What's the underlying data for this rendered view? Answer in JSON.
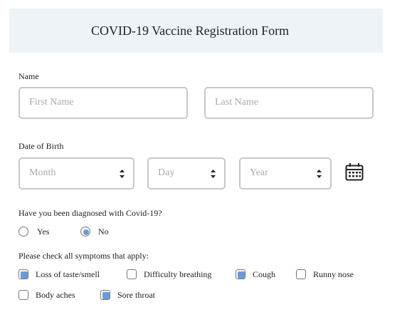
{
  "form": {
    "title": "COVID-19 Vaccine Registration Form"
  },
  "name": {
    "label": "Name",
    "first_placeholder": "First Name",
    "last_placeholder": "Last Name"
  },
  "dob": {
    "label": "Date of Birth",
    "month_placeholder": "Month",
    "day_placeholder": "Day",
    "year_placeholder": "Year",
    "calendar_icon": "calendar-icon"
  },
  "diagnosed": {
    "question": "Have you been diagnosed with Covid-19?",
    "options": [
      {
        "label": "Yes",
        "selected": false
      },
      {
        "label": "No",
        "selected": true
      }
    ]
  },
  "symptoms": {
    "question": "Please check all symptoms that apply:",
    "options": [
      {
        "label": "Loss of taste/smell",
        "checked": true
      },
      {
        "label": "Difficulty breathing",
        "checked": false
      },
      {
        "label": "Cough",
        "checked": true
      },
      {
        "label": "Runny nose",
        "checked": false
      },
      {
        "label": "Body aches",
        "checked": false
      },
      {
        "label": "Sore throat",
        "checked": true
      }
    ]
  },
  "colors": {
    "header_bg": "#eef3f8",
    "accent": "#6b9bd6",
    "border": "#c8c8c8"
  }
}
